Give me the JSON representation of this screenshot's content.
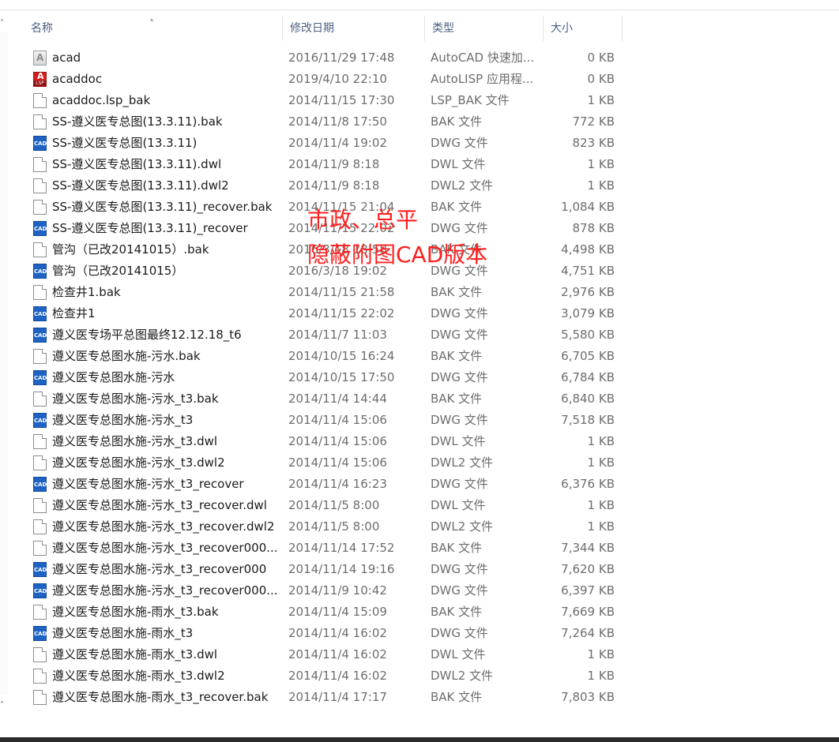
{
  "columns": {
    "name": "名称",
    "date": "修改日期",
    "type": "类型",
    "size": "大小"
  },
  "overlay": {
    "line1": "市政、总平",
    "line2": "隐蔽附图CAD版本",
    "color": "#ff1e1e"
  },
  "accent_colors": {
    "header_text": "#4d6082",
    "cad_icon": "#1e63c4",
    "lsp_icon": "#d21f1f"
  },
  "files": [
    {
      "name": "acad",
      "date": "2016/11/29 17:48",
      "type": "AutoCAD 快速加...",
      "size": "0 KB",
      "icon": "autocad-shortcut-icon"
    },
    {
      "name": "acaddoc",
      "date": "2019/4/10 22:10",
      "type": "AutoLISP 应用程...",
      "size": "0 KB",
      "icon": "autolisp-file-icon"
    },
    {
      "name": "acaddoc.lsp_bak",
      "date": "2014/11/15 17:30",
      "type": "LSP_BAK 文件",
      "size": "1 KB",
      "icon": "generic-file-icon"
    },
    {
      "name": "SS-遵义医专总图(13.3.11).bak",
      "date": "2014/11/8 17:50",
      "type": "BAK 文件",
      "size": "772 KB",
      "icon": "generic-file-icon"
    },
    {
      "name": "SS-遵义医专总图(13.3.11)",
      "date": "2014/11/4 19:02",
      "type": "DWG 文件",
      "size": "823 KB",
      "icon": "dwg-file-icon"
    },
    {
      "name": "SS-遵义医专总图(13.3.11).dwl",
      "date": "2014/11/9 8:18",
      "type": "DWL 文件",
      "size": "1 KB",
      "icon": "generic-file-icon"
    },
    {
      "name": "SS-遵义医专总图(13.3.11).dwl2",
      "date": "2014/11/9 8:18",
      "type": "DWL2 文件",
      "size": "1 KB",
      "icon": "generic-file-icon"
    },
    {
      "name": "SS-遵义医专总图(13.3.11)_recover.bak",
      "date": "2014/11/15 21:04",
      "type": "BAK 文件",
      "size": "1,084 KB",
      "icon": "generic-file-icon"
    },
    {
      "name": "SS-遵义医专总图(13.3.11)_recover",
      "date": "2014/11/15 22:02",
      "type": "DWG 文件",
      "size": "878 KB",
      "icon": "dwg-file-icon"
    },
    {
      "name": "管沟（已改20141015）.bak",
      "date": "2016/3/18 18:58",
      "type": "BAK 文件",
      "size": "4,498 KB",
      "icon": "generic-file-icon"
    },
    {
      "name": "管沟（已改20141015）",
      "date": "2016/3/18 19:02",
      "type": "DWG 文件",
      "size": "4,751 KB",
      "icon": "dwg-file-icon"
    },
    {
      "name": "检查井1.bak",
      "date": "2014/11/15 21:58",
      "type": "BAK 文件",
      "size": "2,976 KB",
      "icon": "generic-file-icon"
    },
    {
      "name": "检查井1",
      "date": "2014/11/15 22:02",
      "type": "DWG 文件",
      "size": "3,079 KB",
      "icon": "dwg-file-icon"
    },
    {
      "name": "遵义医专场平总图最终12.12.18_t6",
      "date": "2014/11/7 11:03",
      "type": "DWG 文件",
      "size": "5,580 KB",
      "icon": "dwg-file-icon"
    },
    {
      "name": "遵义医专总图水施-污水.bak",
      "date": "2014/10/15 16:24",
      "type": "BAK 文件",
      "size": "6,705 KB",
      "icon": "generic-file-icon"
    },
    {
      "name": "遵义医专总图水施-污水",
      "date": "2014/10/15 17:50",
      "type": "DWG 文件",
      "size": "6,784 KB",
      "icon": "dwg-file-icon"
    },
    {
      "name": "遵义医专总图水施-污水_t3.bak",
      "date": "2014/11/4 14:44",
      "type": "BAK 文件",
      "size": "6,840 KB",
      "icon": "generic-file-icon"
    },
    {
      "name": "遵义医专总图水施-污水_t3",
      "date": "2014/11/4 15:06",
      "type": "DWG 文件",
      "size": "7,518 KB",
      "icon": "dwg-file-icon"
    },
    {
      "name": "遵义医专总图水施-污水_t3.dwl",
      "date": "2014/11/4 15:06",
      "type": "DWL 文件",
      "size": "1 KB",
      "icon": "generic-file-icon"
    },
    {
      "name": "遵义医专总图水施-污水_t3.dwl2",
      "date": "2014/11/4 15:06",
      "type": "DWL2 文件",
      "size": "1 KB",
      "icon": "generic-file-icon"
    },
    {
      "name": "遵义医专总图水施-污水_t3_recover",
      "date": "2014/11/4 16:23",
      "type": "DWG 文件",
      "size": "6,376 KB",
      "icon": "dwg-file-icon"
    },
    {
      "name": "遵义医专总图水施-污水_t3_recover.dwl",
      "date": "2014/11/5 8:00",
      "type": "DWL 文件",
      "size": "1 KB",
      "icon": "generic-file-icon"
    },
    {
      "name": "遵义医专总图水施-污水_t3_recover.dwl2",
      "date": "2014/11/5 8:00",
      "type": "DWL2 文件",
      "size": "1 KB",
      "icon": "generic-file-icon"
    },
    {
      "name": "遵义医专总图水施-污水_t3_recover000...",
      "date": "2014/11/14 17:52",
      "type": "BAK 文件",
      "size": "7,344 KB",
      "icon": "generic-file-icon"
    },
    {
      "name": "遵义医专总图水施-污水_t3_recover000",
      "date": "2014/11/14 19:16",
      "type": "DWG 文件",
      "size": "7,620 KB",
      "icon": "dwg-file-icon"
    },
    {
      "name": "遵义医专总图水施-污水_t3_recover000...",
      "date": "2014/11/9 10:42",
      "type": "DWG 文件",
      "size": "6,397 KB",
      "icon": "dwg-file-icon"
    },
    {
      "name": "遵义医专总图水施-雨水_t3.bak",
      "date": "2014/11/4 15:09",
      "type": "BAK 文件",
      "size": "7,669 KB",
      "icon": "generic-file-icon"
    },
    {
      "name": "遵义医专总图水施-雨水_t3",
      "date": "2014/11/4 16:02",
      "type": "DWG 文件",
      "size": "7,264 KB",
      "icon": "dwg-file-icon"
    },
    {
      "name": "遵义医专总图水施-雨水_t3.dwl",
      "date": "2014/11/4 16:02",
      "type": "DWL 文件",
      "size": "1 KB",
      "icon": "generic-file-icon"
    },
    {
      "name": "遵义医专总图水施-雨水_t3.dwl2",
      "date": "2014/11/4 16:02",
      "type": "DWL2 文件",
      "size": "1 KB",
      "icon": "generic-file-icon"
    },
    {
      "name": "遵义医专总图水施-雨水_t3_recover.bak",
      "date": "2014/11/4 17:17",
      "type": "BAK 文件",
      "size": "7,803 KB",
      "icon": "generic-file-icon"
    }
  ]
}
